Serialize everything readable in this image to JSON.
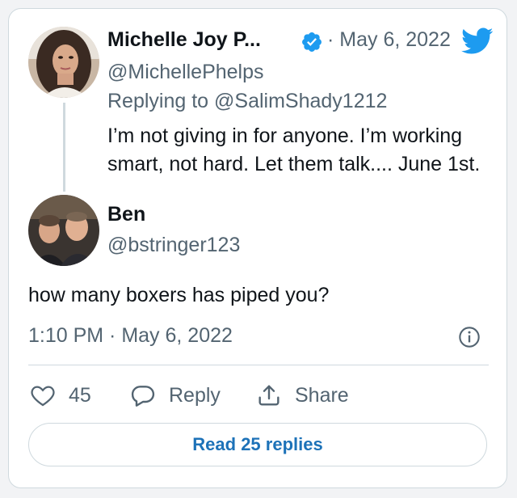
{
  "tweet": {
    "author": {
      "name": "Michelle Joy P...",
      "handle": "@MichellePhelps",
      "verified": true
    },
    "date": "· May 6, 2022",
    "replying_prefix": "Replying to ",
    "replying_handle": "@SalimShady1212",
    "text_line1": "I’m not giving in for anyone. I’m working",
    "text_line2": "smart, not hard. Let them talk.... June 1st."
  },
  "reply": {
    "author": {
      "name": "Ben",
      "handle": "@bstringer123"
    },
    "text": "how many boxers has piped you?",
    "timestamp": "1:10 PM · May 6, 2022"
  },
  "actions": {
    "like_count": "45",
    "reply_label": "Reply",
    "share_label": "Share"
  },
  "read_replies_label": "Read 25 replies",
  "colors": {
    "twitter_blue": "#1d9bf0",
    "link_blue": "#1d72b8",
    "secondary_text": "#536471",
    "border": "#cfd9de"
  }
}
